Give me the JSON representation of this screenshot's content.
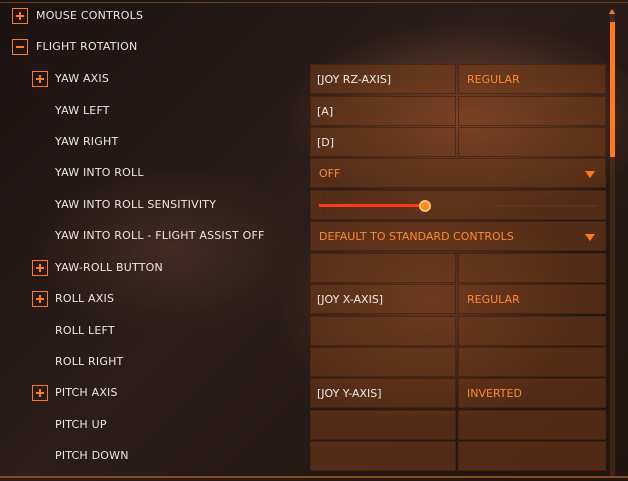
{
  "controls": {
    "mouse_controls": "MOUSE CONTROLS",
    "flight_rotation": "FLIGHT ROTATION",
    "yaw_axis": {
      "label": "YAW AXIS",
      "binding": "[JOY RZ-AXIS]",
      "mode": "REGULAR"
    },
    "yaw_left": {
      "label": "YAW LEFT",
      "binding": "[A]"
    },
    "yaw_right": {
      "label": "YAW RIGHT",
      "binding": "[D]"
    },
    "yaw_into_roll": {
      "label": "YAW INTO ROLL",
      "value": "OFF"
    },
    "yaw_into_roll_sensitivity": {
      "label": "YAW INTO ROLL SENSITIVITY",
      "level": 0.38
    },
    "yaw_into_roll_fa_off": {
      "label": "YAW INTO ROLL - FLIGHT ASSIST OFF",
      "value": "DEFAULT TO STANDARD CONTROLS"
    },
    "yaw_roll_button": {
      "label": "YAW-ROLL BUTTON"
    },
    "roll_axis": {
      "label": "ROLL AXIS",
      "binding": "[JOY X-AXIS]",
      "mode": "REGULAR"
    },
    "roll_left": {
      "label": "ROLL LEFT"
    },
    "roll_right": {
      "label": "ROLL RIGHT"
    },
    "pitch_axis": {
      "label": "PITCH AXIS",
      "binding": "[JOY Y-AXIS]",
      "mode": "INVERTED"
    },
    "pitch_up": {
      "label": "PITCH UP"
    },
    "pitch_down": {
      "label": "PITCH DOWN"
    }
  },
  "icons": {
    "expand": "plus-icon",
    "collapse": "minus-icon",
    "dropdown": "triangle-down-icon"
  },
  "colors": {
    "accent": "#ff7a1a",
    "slider_fill": "#ff3a10",
    "cell_bg": "#783c19"
  }
}
